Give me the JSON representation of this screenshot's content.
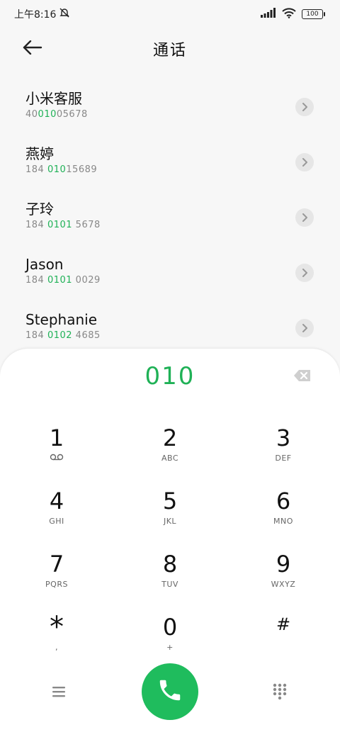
{
  "status": {
    "time": "上午8:16",
    "battery": "100"
  },
  "header": {
    "title": "通话"
  },
  "contacts": [
    {
      "name": "小米客服",
      "number_pre": "40",
      "number_hl": "010",
      "number_post": "05678"
    },
    {
      "name": "燕婷",
      "number_pre": "184 ",
      "number_hl": "010",
      "number_post": "15689"
    },
    {
      "name": "子玲",
      "number_pre": "184 ",
      "number_hl": "0101",
      "number_post": " 5678"
    },
    {
      "name": "Jason",
      "number_pre": "184 ",
      "number_hl": "0101",
      "number_post": " 0029"
    },
    {
      "name": "Stephanie",
      "number_pre": "184 ",
      "number_hl": "0102",
      "number_post": " 4685"
    }
  ],
  "dialer": {
    "input": "010"
  },
  "keys": [
    {
      "digit": "1",
      "letters": ""
    },
    {
      "digit": "2",
      "letters": "ABC"
    },
    {
      "digit": "3",
      "letters": "DEF"
    },
    {
      "digit": "4",
      "letters": "GHI"
    },
    {
      "digit": "5",
      "letters": "JKL"
    },
    {
      "digit": "6",
      "letters": "MNO"
    },
    {
      "digit": "7",
      "letters": "PQRS"
    },
    {
      "digit": "8",
      "letters": "TUV"
    },
    {
      "digit": "9",
      "letters": "WXYZ"
    },
    {
      "digit": "*",
      "letters": ","
    },
    {
      "digit": "0",
      "letters": "+"
    },
    {
      "digit": "#",
      "letters": ""
    }
  ],
  "colors": {
    "accent": "#1fb156",
    "call_button": "#1fbc5d"
  },
  "icons": {
    "back": "arrow-left-icon",
    "voicemail": "voicemail-icon",
    "backspace": "backspace-icon",
    "menu": "menu-icon",
    "call": "phone-icon",
    "dialpad": "dialpad-icon"
  }
}
